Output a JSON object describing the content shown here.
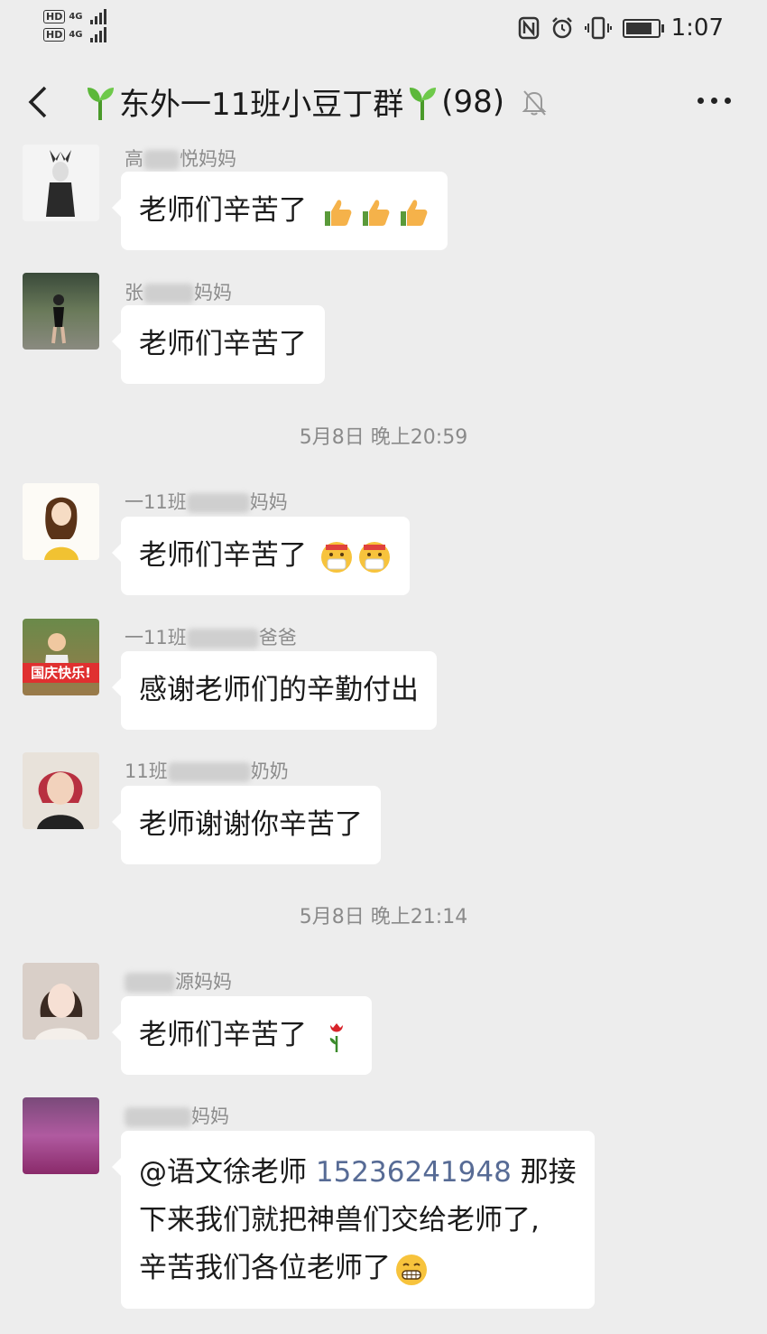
{
  "status_bar": {
    "sim1": "HD",
    "sim2": "HD",
    "net1": "4G",
    "net2": "4G",
    "time": "1:07"
  },
  "header": {
    "title": "东外一11班小豆丁群",
    "count": "(98)"
  },
  "timestamps": [
    "5月8日 晚上20:59",
    "5月8日 晚上21:14"
  ],
  "messages": [
    {
      "sender_pre": "高",
      "sender_post": "悦妈妈",
      "text": "老师们辛苦了",
      "emoji": [
        "thumbs-up",
        "thumbs-up",
        "thumbs-up"
      ]
    },
    {
      "sender_pre": "张",
      "sender_post": "妈妈",
      "text": "老师们辛苦了",
      "emoji": []
    },
    {
      "sender_pre": "一11班",
      "sender_post": "妈妈",
      "text": "老师们辛苦了",
      "emoji": [
        "mask-face",
        "mask-face"
      ]
    },
    {
      "sender_pre": "一11班",
      "sender_post": "爸爸",
      "text": "感谢老师们的辛勤付出",
      "emoji": [],
      "avatar_badge": "国庆快乐!"
    },
    {
      "sender_pre": "11班",
      "sender_post": "奶奶",
      "text": "老师谢谢你辛苦了",
      "emoji": []
    },
    {
      "sender_pre": "",
      "sender_post": "源妈妈",
      "text": "老师们辛苦了",
      "emoji": [
        "rose"
      ]
    },
    {
      "sender_pre": "",
      "sender_post": "妈妈",
      "line1_a": "@语文徐老师 ",
      "line1_phone": "15236241948",
      "line1_b": " 那接",
      "line2": "下来我们就把神兽们交给老师了,",
      "line3": "辛苦我们各位老师了",
      "emoji": [
        "grimace"
      ]
    }
  ]
}
